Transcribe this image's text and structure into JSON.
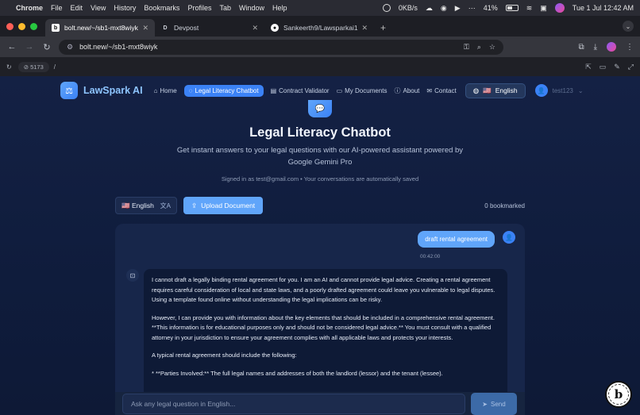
{
  "os_menubar": {
    "app_name": "Chrome",
    "menus": [
      "File",
      "Edit",
      "View",
      "History",
      "Bookmarks",
      "Profiles",
      "Tab",
      "Window",
      "Help"
    ],
    "network_speed": "0KB/s",
    "battery": "41%",
    "datetime": "Tue 1 Jul  12:42 AM"
  },
  "browser": {
    "tabs": [
      {
        "favicon": "b",
        "title": "bolt.new/~/sb1-mxt8wiyk",
        "active": true
      },
      {
        "favicon": "D",
        "title": "Devpost",
        "active": false
      },
      {
        "favicon": "github-icon",
        "title": "Sankeerth9/Lawsparkai1",
        "active": false
      }
    ],
    "url": "bolt.new/~/sb1-mxt8wiyk",
    "preview_port": "5173",
    "preview_path": "/"
  },
  "app": {
    "brand": "LawSpark AI",
    "nav": [
      {
        "icon": "home-icon",
        "glyph": "⌂",
        "label": "Home",
        "active": false
      },
      {
        "icon": "chat-icon",
        "glyph": "◌",
        "label": "Legal Literacy Chatbot",
        "active": true
      },
      {
        "icon": "document-icon",
        "glyph": "▤",
        "label": "Contract Validator",
        "active": false
      },
      {
        "icon": "folder-icon",
        "glyph": "▭",
        "label": "My Documents",
        "active": false
      },
      {
        "icon": "info-icon",
        "glyph": "ⓘ",
        "label": "About",
        "active": false
      },
      {
        "icon": "mail-icon",
        "glyph": "✉",
        "label": "Contact",
        "active": false
      }
    ],
    "language_button": "English",
    "username": "test123",
    "page_title": "Legal Literacy Chatbot",
    "subtitle": "Get instant answers to your legal questions with our AI-powered assistant powered by Google Gemini Pro",
    "signed_in_text": "Signed in as test@gmail.com • Your conversations are automatically saved",
    "language_select": "English",
    "upload_label": "Upload Document",
    "bookmarked_text": "0 bookmarked",
    "user_message": "draft rental agreement",
    "user_message_time": "00:42:00",
    "bot_paragraphs": [
      "I cannot draft a legally binding rental agreement for you.  I am an AI and cannot provide legal advice.  Creating a rental agreement requires careful consideration of local and state laws, and a poorly drafted agreement could leave you vulnerable to legal disputes.  Using a template found online without understanding the legal implications can be risky.",
      "However, I can provide you with information about the key elements that should be included in a comprehensive rental agreement.  **This information is for educational purposes only and should not be considered legal advice.** You must consult with a qualified attorney in your jurisdiction to ensure your agreement complies with all applicable laws and protects your interests.",
      "A typical rental agreement should include the following:",
      "* **Parties Involved:**  The full legal names and addresses of both the landlord (lessor) and the tenant (lessee)."
    ],
    "input_placeholder": "Ask any legal question in English...",
    "send_label": "Send",
    "badge_letter": "b"
  }
}
